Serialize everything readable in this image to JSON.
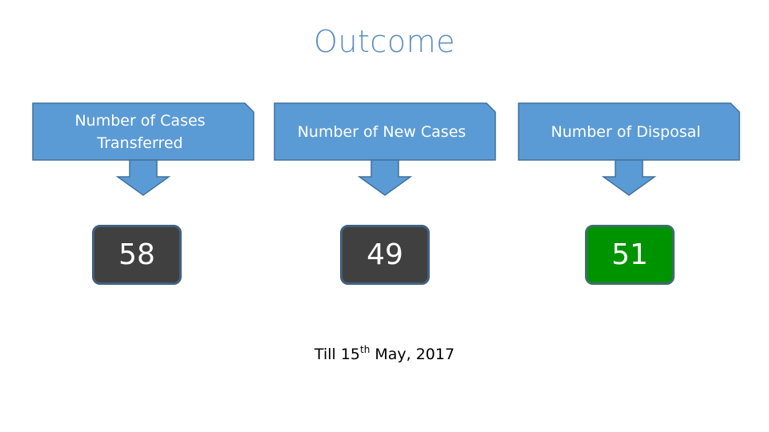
{
  "title": "Outcome",
  "callouts": [
    {
      "label": "Number of Cases Transferred",
      "value": "58",
      "style": "dark"
    },
    {
      "label": "Number of New Cases",
      "value": "49",
      "style": "dark"
    },
    {
      "label": "Number of Disposal",
      "value": "51",
      "style": "green"
    }
  ],
  "footnote": {
    "prefix": "Till 15",
    "sup": "th",
    "suffix": " May, 2017"
  },
  "colors": {
    "callout_fill": "#5b9bd5",
    "callout_border": "#41719c",
    "title": "#5b8ec4",
    "value_dark": "#404040",
    "value_green": "#009300"
  }
}
